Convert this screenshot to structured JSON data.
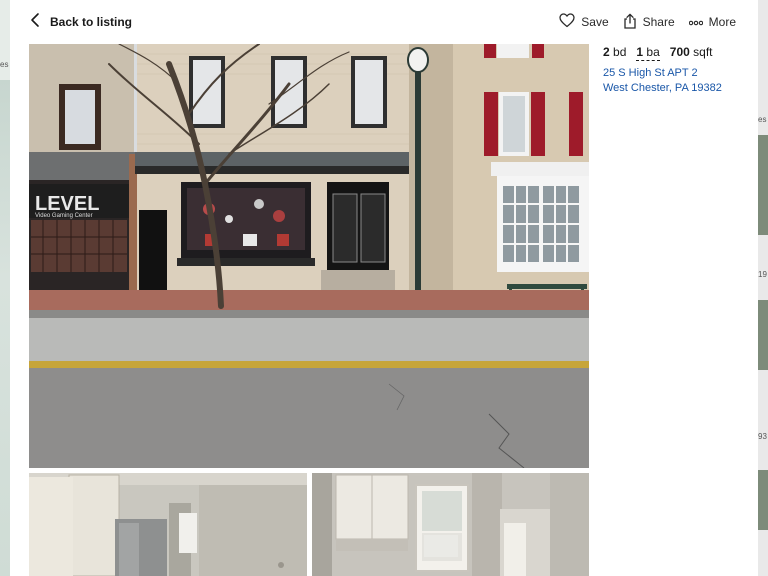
{
  "header": {
    "back_label": "Back to listing",
    "actions": [
      {
        "label": "Save",
        "icon": "heart-icon"
      },
      {
        "label": "Share",
        "icon": "share-icon"
      },
      {
        "label": "More",
        "icon": "more-icon"
      }
    ]
  },
  "listing": {
    "beds_num": "2",
    "beds_unit": "bd",
    "baths_num": "1",
    "baths_unit": "ba",
    "sqft_num": "700",
    "sqft_unit": "sqft",
    "address_line1": "25 S High St APT 2",
    "address_line2": "West Chester, PA 19382"
  },
  "photos": {
    "storefront_sign": "LEVEL",
    "storefront_sub": "Video Gaming Center"
  },
  "background": {
    "left_peek": "es",
    "right_peek": [
      "es",
      "19",
      "93"
    ]
  },
  "colors": {
    "link": "#1a57a8",
    "text": "#1a1a1a"
  }
}
